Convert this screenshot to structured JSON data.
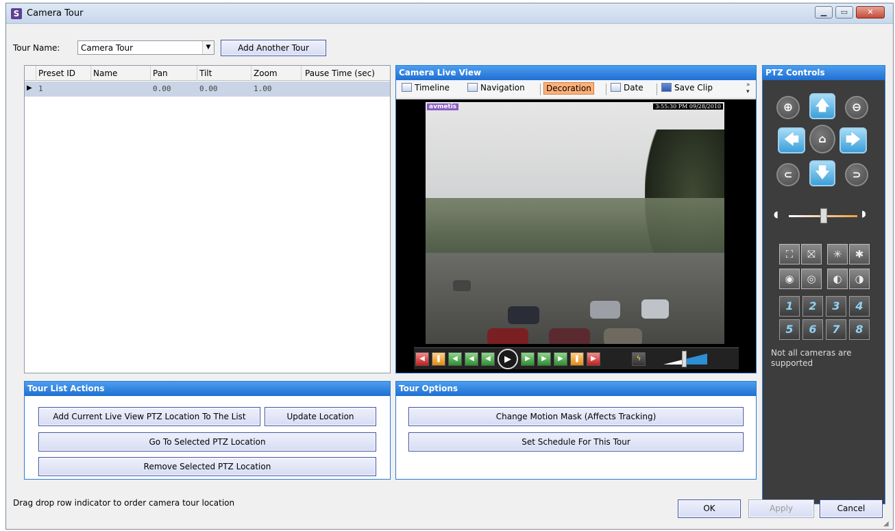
{
  "window": {
    "title": "Camera Tour",
    "app_icon": "S"
  },
  "tour_name": {
    "label": "Tour Name:",
    "value": "Camera Tour",
    "add_button": "Add Another Tour"
  },
  "grid": {
    "columns": [
      "Preset ID",
      "Name",
      "Pan",
      "Tilt",
      "Zoom",
      "Pause Time (sec)"
    ],
    "rows": [
      {
        "preset_id": "1",
        "name": "",
        "pan": "0.00",
        "tilt": "0.00",
        "zoom": "1.00",
        "pause": ""
      }
    ]
  },
  "live_view": {
    "title": "Camera Live View",
    "toolbar": {
      "timeline": "Timeline",
      "navigation": "Navigation",
      "decoration": "Decoration",
      "date": "Date",
      "save_clip": "Save Clip"
    },
    "overlay": {
      "brand": "avmetis",
      "timestamp": "3:55:30 PM 09/28/2010"
    }
  },
  "ptz": {
    "title": "PTZ Controls",
    "note": "Not all cameras are supported",
    "presets": [
      "1",
      "2",
      "3",
      "4",
      "5",
      "6",
      "7",
      "8"
    ]
  },
  "tour_list_actions": {
    "title": "Tour List Actions",
    "add_current": "Add Current Live View PTZ Location To The List",
    "update": "Update Location",
    "go_to": "Go To Selected PTZ Location",
    "remove": "Remove Selected PTZ Location"
  },
  "tour_options": {
    "title": "Tour Options",
    "motion_mask": "Change Motion Mask (Affects Tracking)",
    "schedule": "Set Schedule For This Tour"
  },
  "footer": {
    "hint": "Drag  drop row indicator to order camera tour location",
    "ok": "OK",
    "apply": "Apply",
    "cancel": "Cancel"
  },
  "colors": {
    "panel_header": "#1f6fd1",
    "ptz_background": "#3d3d3d",
    "decoration_highlight": "#ffb07a"
  }
}
